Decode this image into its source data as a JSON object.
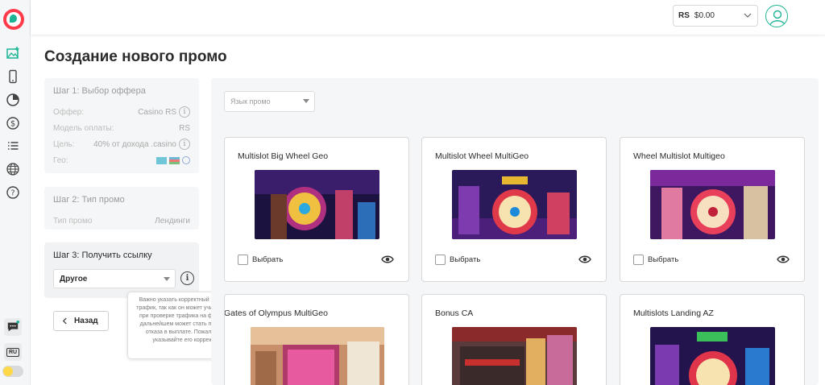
{
  "header": {
    "balance_currency": "RS",
    "balance_amount": "$0.00"
  },
  "page": {
    "title": "Создание нового промо"
  },
  "step1": {
    "title": "Шаг 1: Выбор оффера",
    "rows": [
      {
        "label": "Оффер:",
        "value": "Casino RS"
      },
      {
        "label": "Модель оплаты:",
        "value": "RS"
      },
      {
        "label": "Цель:",
        "value": "40% от дохода .casino"
      },
      {
        "label": "Гео:",
        "value": ""
      }
    ]
  },
  "step2": {
    "title": "Шаг 2: Тип промо",
    "label": "Тип промо",
    "value": "Лендинги"
  },
  "step3": {
    "title": "Шаг 3: Получить ссылку",
    "select_value": "Другое",
    "tooltip": "Важно указать корректный источник трафик, так как он может учитываться при проверке трафика на фрод. И в дальнейшем может стать причиной отказа в выплате. Пожалуйста, указывайте его корректно"
  },
  "back_button": "Назад",
  "filters": {
    "language_placeholder": "Язык промо"
  },
  "choose_label": "Выбрать",
  "cards": [
    {
      "title": "Multislot Big Wheel Geo"
    },
    {
      "title": "Multislot Wheel MultiGeo"
    },
    {
      "title": "Wheel Multislot Multigeo"
    },
    {
      "title": "Gates of Olympus MultiGeo"
    },
    {
      "title": "Bonus CA"
    },
    {
      "title": "Multislots Landing AZ"
    }
  ],
  "rail": {
    "language_badge": "RU"
  },
  "colors": {
    "accent": "#1ab394",
    "brand": "#ff3b4a",
    "panel_bg": "#f5f6f7"
  }
}
